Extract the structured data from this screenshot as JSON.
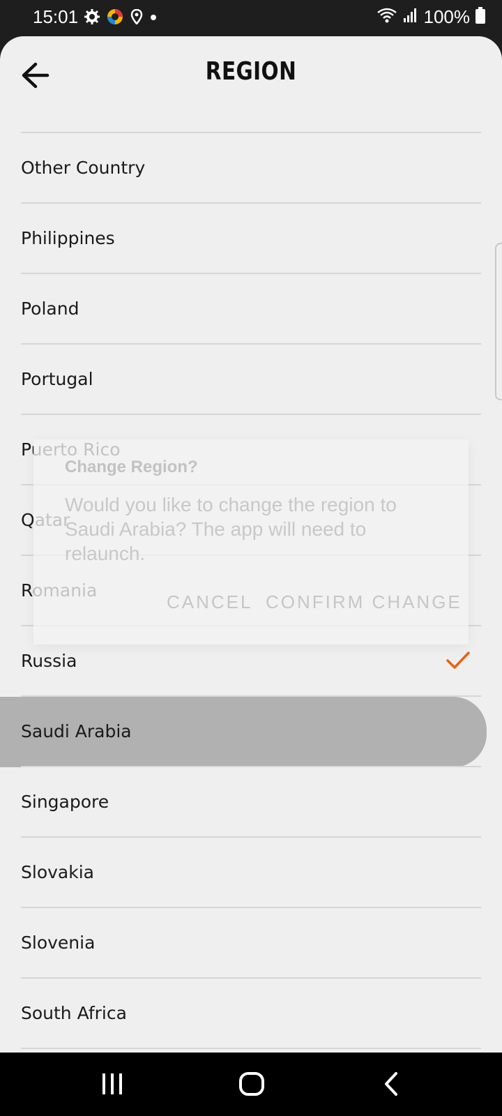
{
  "status": {
    "time": "15:01",
    "battery": "100%",
    "icons_left": [
      "gear-icon",
      "color-app-icon",
      "location-icon",
      "dot-icon"
    ],
    "icons_right": [
      "wifi-icon",
      "signal-icon",
      "battery-icon"
    ]
  },
  "header": {
    "title": "REGION",
    "back_icon": "arrow-left-icon"
  },
  "regions": [
    {
      "label": "Other Country",
      "selected": false,
      "pressed": false
    },
    {
      "label": "Philippines",
      "selected": false,
      "pressed": false
    },
    {
      "label": "Poland",
      "selected": false,
      "pressed": false
    },
    {
      "label": "Portugal",
      "selected": false,
      "pressed": false
    },
    {
      "label": "Puerto Rico",
      "selected": false,
      "pressed": false
    },
    {
      "label": "Qatar",
      "selected": false,
      "pressed": false
    },
    {
      "label": "Romania",
      "selected": false,
      "pressed": false
    },
    {
      "label": "Russia",
      "selected": true,
      "pressed": false
    },
    {
      "label": "Saudi Arabia",
      "selected": false,
      "pressed": true
    },
    {
      "label": "Singapore",
      "selected": false,
      "pressed": false
    },
    {
      "label": "Slovakia",
      "selected": false,
      "pressed": false
    },
    {
      "label": "Slovenia",
      "selected": false,
      "pressed": false
    },
    {
      "label": "South Africa",
      "selected": false,
      "pressed": false
    }
  ],
  "dialog": {
    "title": "Change Region?",
    "message": "Would you like to change the region to Saudi Arabia? The app will need to relaunch.",
    "cancel_label": "CANCEL",
    "confirm_label": "CONFIRM CHANGE"
  },
  "nav": {
    "recents_icon": "recents-icon",
    "home_icon": "home-icon",
    "back_icon": "back-chevron-icon"
  },
  "colors": {
    "accent_check": "#e8620f",
    "sheet_bg": "#efefef",
    "pressed_row": "#b1b1b1",
    "bars": "#000000"
  }
}
